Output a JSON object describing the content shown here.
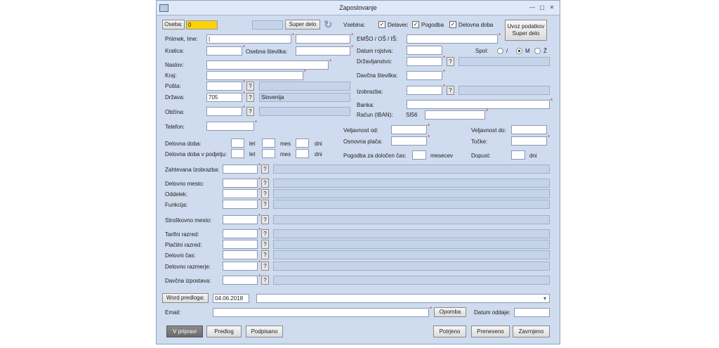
{
  "window": {
    "title": "Zaposlovanje",
    "minimize": "—",
    "restore": "▢",
    "close": "✕"
  },
  "top": {
    "oseba_label": "Oseba:",
    "oseba_value": "0",
    "super_delo": "Super delo",
    "refresh_icon": "↻"
  },
  "vsebina": {
    "label": "Vsebina:",
    "items": [
      "Delavec",
      "Pogodba",
      "Delovna doba"
    ],
    "checked": "✓"
  },
  "uvoz": "Uvoz podatkov Super delo",
  "left": {
    "priimek": "Priimek, Ime:",
    "priimek_value": "|",
    "kratica": "Kratica:",
    "osebna": "Osebna številka:",
    "naslov": "Naslov:",
    "kraj": "Kraj:",
    "posta": "Pošta:",
    "drzava": "Država:",
    "drzava_code": "705",
    "drzava_name": "Slovenija",
    "obcina": "Občina:",
    "telefon": "Telefon:"
  },
  "right": {
    "emso": "EMŠO / OŠ / IŠ:",
    "datum_rojstva": "Datum rojstva:",
    "spol": "Spol:",
    "spol_opts": [
      "/",
      "M",
      "Ž"
    ],
    "drzavljanstvo": "Državljanstvo:",
    "davcna": "Davčna številka:",
    "izobrazba": "Izobrazba:",
    "banka": "Banka:",
    "racun": "Račun (IBAN):",
    "iban_prefix": "SI56"
  },
  "work": {
    "delovna_doba": "Delovna doba:",
    "delovna_doba_podjetje": "Delovna doba v podjetju:",
    "let": "let",
    "mes": "mes",
    "dni": "dni",
    "veljavnost_od": "Veljavnost od:",
    "osnovna_placa": "Osnovna plača:",
    "pogodba": "Pogodba za določen čas:",
    "mesecev": "mesecev",
    "veljavnost_do": "Veljavnost do:",
    "tocke": "Točke:",
    "dopust": "Dopust:",
    "dopust_unit": "dni"
  },
  "codes": [
    "Zahtevana Izobrazba:",
    "Delovno mesto:",
    "Oddelek:",
    "Funkcija:",
    "Stroškovno mesto:",
    "Tarifni razred:",
    "Plačilni razred:",
    "Delovni čas:",
    "Delovno razmerje:",
    "Davčna izpostava:"
  ],
  "q": "?",
  "bottom": {
    "word_predloga": "Word predloga:",
    "date": "04.06.2018",
    "dropdown": "▾",
    "email": "Email:",
    "opomba": "Opomba",
    "datum_oddaje": "Datum oddaje:",
    "v_pripravi": "V pripravi",
    "predlog": "Predlog",
    "podpisano": "Podpisano",
    "potrjeno": "Potrjeno",
    "preneseno": "Preneseno",
    "zavrnjeno": "Zavrnjeno"
  }
}
